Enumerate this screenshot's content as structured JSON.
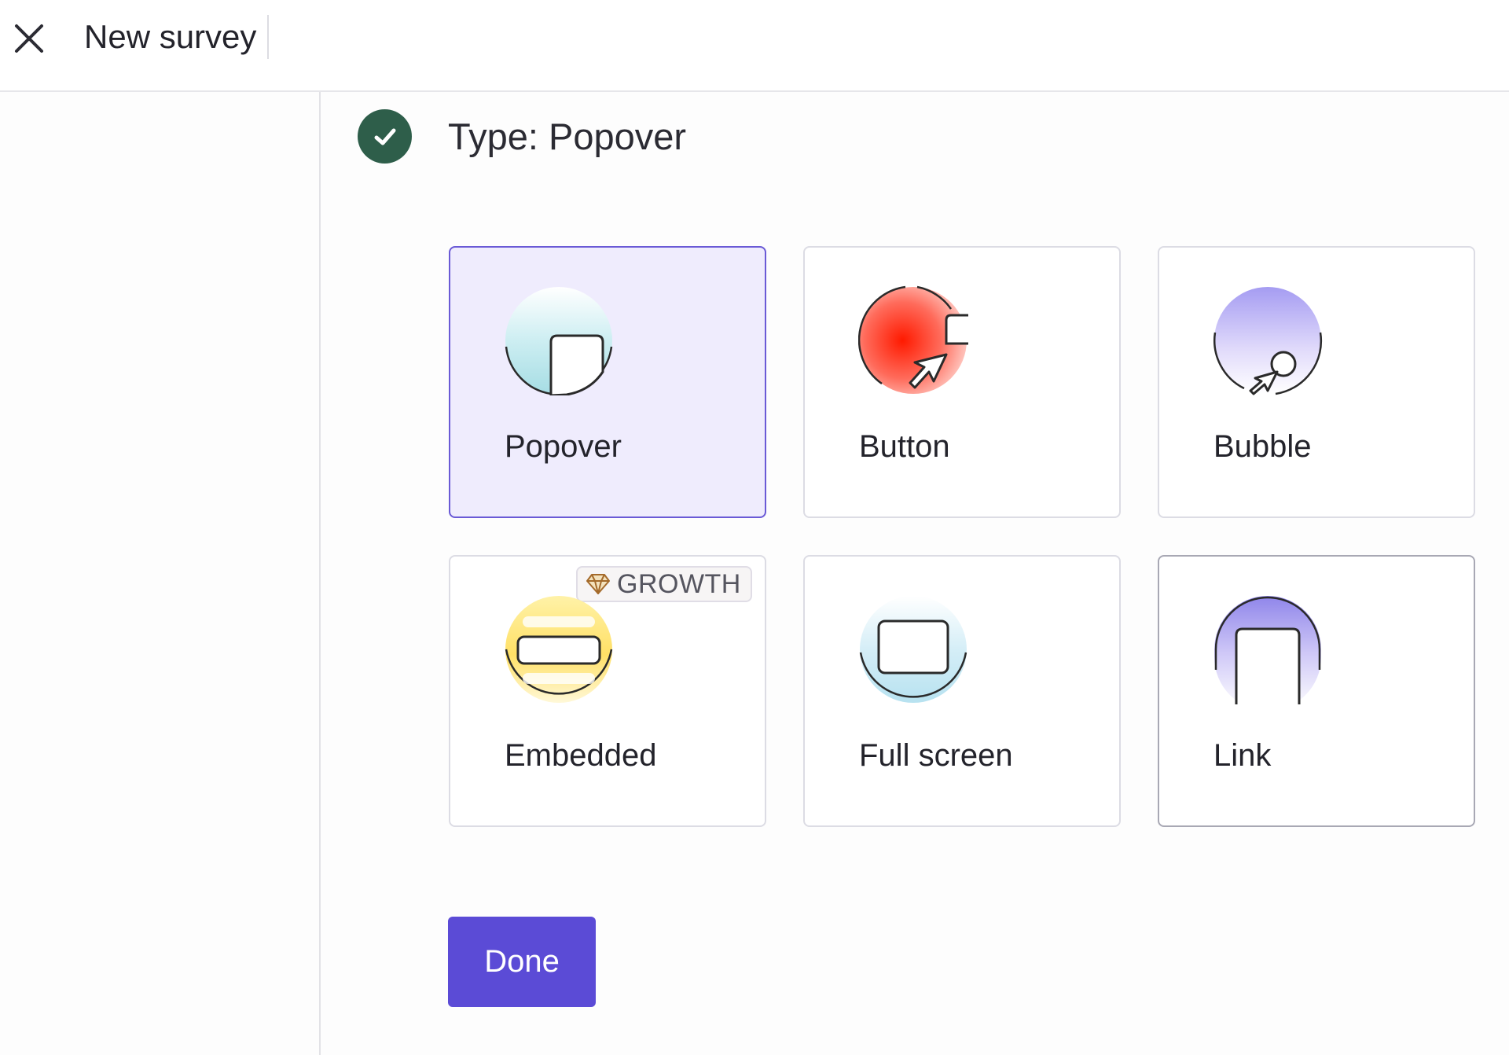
{
  "header": {
    "title": "New survey",
    "close_icon": "close-icon"
  },
  "step": {
    "title": "Type: Popover",
    "status": "completed",
    "status_icon": "check-icon"
  },
  "survey_types": [
    {
      "label": "Popover",
      "icon": "popover-icon",
      "selected": true
    },
    {
      "label": "Button",
      "icon": "button-cursor-icon",
      "selected": false
    },
    {
      "label": "Bubble",
      "icon": "bubble-icon",
      "selected": false
    },
    {
      "label": "Embedded",
      "icon": "embedded-icon",
      "selected": false,
      "badge": {
        "label": "GROWTH",
        "icon": "diamond-icon"
      }
    },
    {
      "label": "Full screen",
      "icon": "full-screen-icon",
      "selected": false
    },
    {
      "label": "Link",
      "icon": "link-icon",
      "selected": false
    }
  ],
  "actions": {
    "done_label": "Done"
  },
  "colors": {
    "accent": "#5b4bd6",
    "selected_card_bg": "#efecfd",
    "success": "#2e5e4a"
  }
}
